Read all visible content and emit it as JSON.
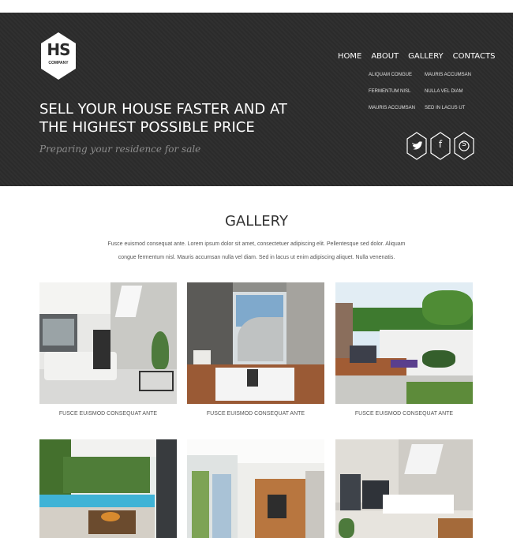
{
  "brand": {
    "logo_letters": "HS",
    "logo_subtext": "COMPANY"
  },
  "nav": {
    "main": [
      "HOME",
      "ABOUT",
      "GALLERY",
      "CONTACTS"
    ],
    "sub": [
      "ALIQUAM CONGUE",
      "MAURIS ACCUMSAN",
      "FERMENTUM NISL",
      "NULLA VEL DIAM",
      "MAURIS ACCUMSAN",
      "SED IN LACUS UT"
    ]
  },
  "hero": {
    "headline_line1": "SELL YOUR HOUSE FASTER AND AT",
    "headline_line2": "THE HIGHEST POSSIBLE PRICE",
    "tagline": "Preparing your residence for sale"
  },
  "social": {
    "icons": [
      "twitter-icon",
      "facebook-icon",
      "skype-icon"
    ],
    "glyphs": [
      "→",
      "f",
      "S"
    ]
  },
  "gallery": {
    "title": "GALLERY",
    "desc_line1": "Fusce euismod consequat ante. Lorem ipsum dolor sit amet, consectetuer adipiscing elit. Pellentesque sed dolor. Aliquam",
    "desc_line2": "congue fermentum nisl. Mauris accumsan nulla vel diam. Sed in lacus ut enim adipiscing aliquet. Nulla venenatis.",
    "captions": [
      "FUSCE EUISMOD CONSEQUAT ANTE",
      "FUSCE EUISMOD CONSEQUAT ANTE",
      "FUSCE EUISMOD CONSEQUAT ANTE"
    ]
  },
  "colors": {
    "header_bg": "#2b2b2b",
    "text_light": "#ffffff",
    "tagline": "#8d8d8d"
  }
}
